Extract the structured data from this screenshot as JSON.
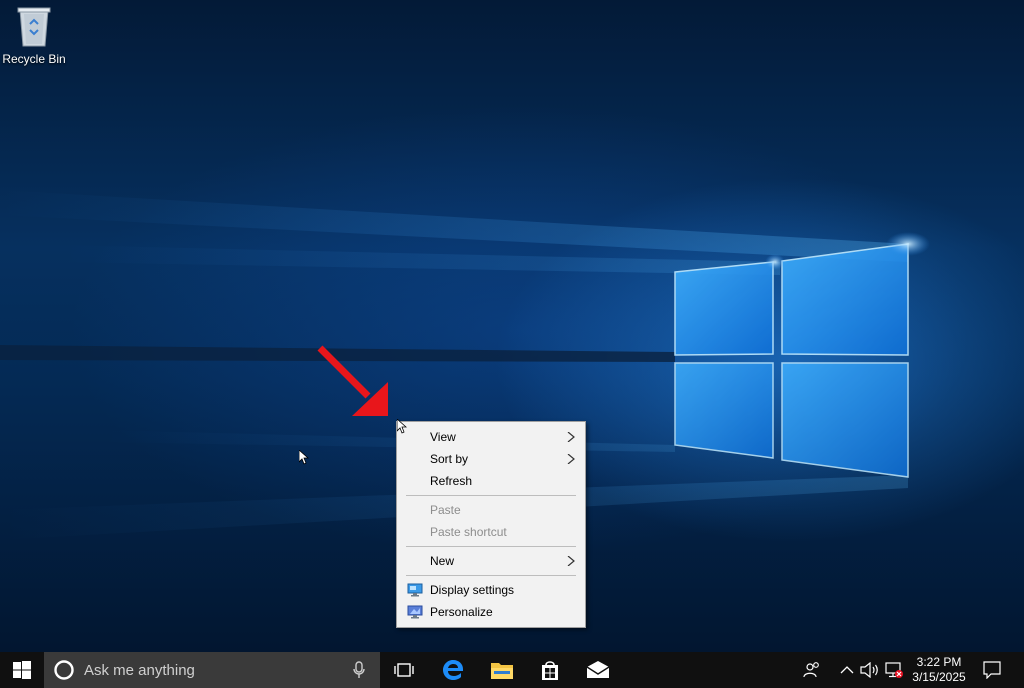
{
  "desktop": {
    "icons": [
      {
        "label": "Recycle Bin",
        "icon": "recycle-bin-icon"
      }
    ]
  },
  "context_menu": {
    "items": [
      {
        "label": "View",
        "submenu": true,
        "enabled": true
      },
      {
        "label": "Sort by",
        "submenu": true,
        "enabled": true
      },
      {
        "label": "Refresh",
        "submenu": false,
        "enabled": true
      },
      {
        "label": "Paste",
        "submenu": false,
        "enabled": false
      },
      {
        "label": "Paste shortcut",
        "submenu": false,
        "enabled": false
      },
      {
        "label": "New",
        "submenu": true,
        "enabled": true
      },
      {
        "label": "Display settings",
        "submenu": false,
        "enabled": true,
        "icon": "display-settings-icon"
      },
      {
        "label": "Personalize",
        "submenu": false,
        "enabled": true,
        "icon": "personalize-icon"
      }
    ]
  },
  "taskbar": {
    "search_placeholder": "Ask me anything",
    "pinned": [
      "task-view-icon",
      "edge-icon",
      "file-explorer-icon",
      "store-icon",
      "mail-icon"
    ],
    "tray": [
      "people-icon",
      "show-hidden-icons-icon",
      "volume-icon",
      "network-disconnected-icon"
    ],
    "clock": {
      "time": "3:22 PM",
      "date": "3/15/2025"
    },
    "action_center_icon": "action-center-icon"
  },
  "colors": {
    "accent": "#0078d7",
    "annotation_arrow": "#e8161b",
    "taskbar": "#101010",
    "search_box": "#3a3a3a",
    "menu_background": "#f2f2f2"
  }
}
